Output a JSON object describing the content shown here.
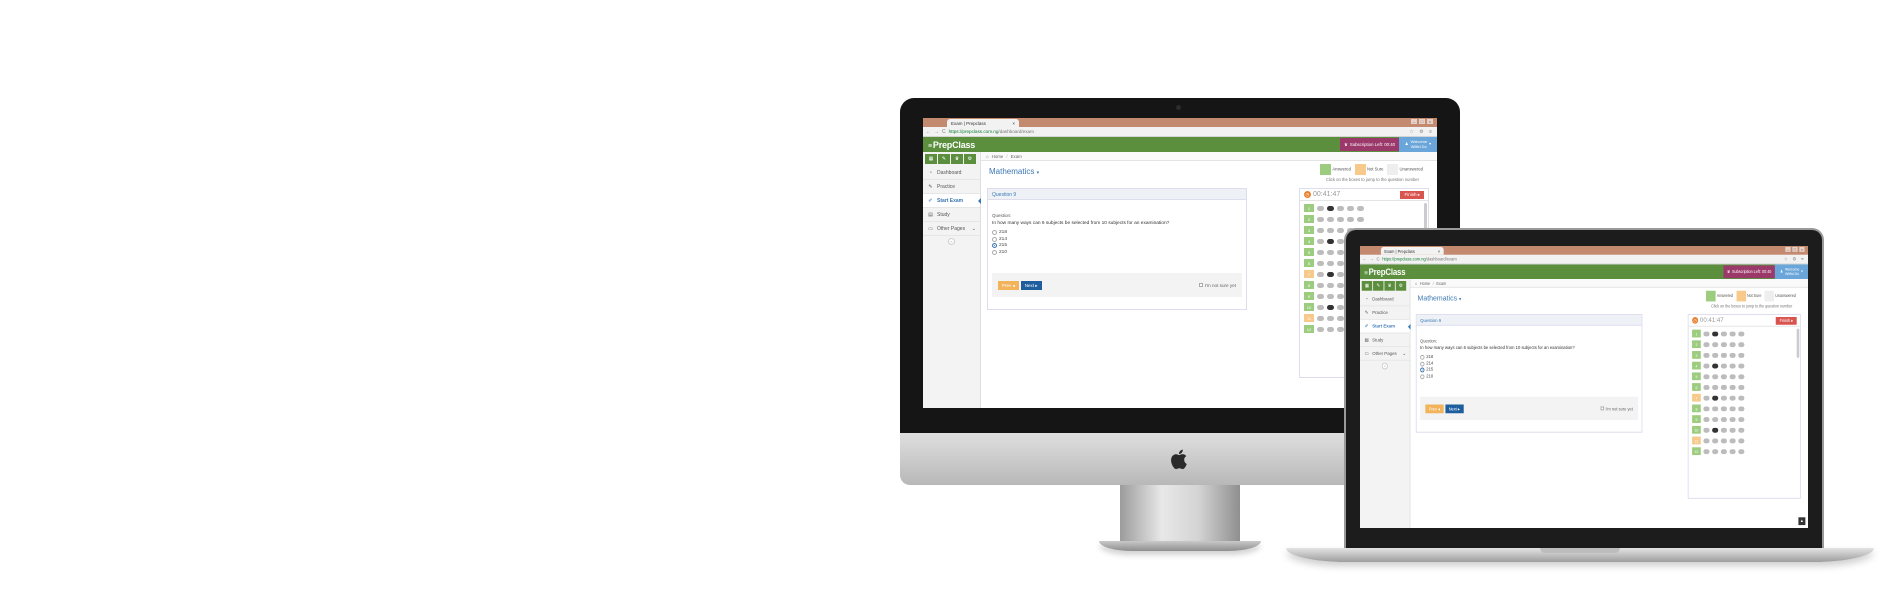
{
  "browser": {
    "tab_title": "Exam | Prepclass",
    "tab_close": "×",
    "url_host": "https://prepclass.com.ng",
    "url_path": "/dashboard/exam",
    "back": "←",
    "forward": "→",
    "reload": "C",
    "icons": "☆ ⚙ ≡",
    "win_min": "–",
    "win_max": "□",
    "win_close": "×"
  },
  "header": {
    "logo_mark": "≡",
    "logo": "PrepClass",
    "subscription_icon": "♛",
    "subscription": "Subscription Left: 00:40",
    "user_icon": "♟",
    "welcome": "Welcome",
    "user": "Wilfid Do",
    "user_caret": "▾"
  },
  "sidebar": {
    "shortcut_icons": [
      "▦",
      "✎",
      "♛",
      "⚙"
    ],
    "items": [
      {
        "icon": "◔",
        "label": "Dashboard"
      },
      {
        "icon": "✎",
        "label": "Practice"
      },
      {
        "icon": "✐",
        "label": "Start Exam"
      },
      {
        "icon": "▤",
        "label": "Study"
      },
      {
        "icon": "▭",
        "label": "Other Pages"
      }
    ],
    "chevron": "⌄",
    "collapse": "«"
  },
  "breadcrumb": {
    "home_icon": "⌂",
    "home": "Home",
    "sep": "/",
    "current": "Exam"
  },
  "page": {
    "title": "Mathematics",
    "caret": "▾"
  },
  "legend": {
    "answered": "Answered",
    "not_sure": "Not Sure",
    "unanswered": "Unanswered",
    "hint": "Click on the boxes to jump to the question number",
    "colors": {
      "answered": "#9ccc7e",
      "not_sure": "#f7c98a",
      "unanswered": "#eeeeee"
    }
  },
  "question": {
    "header": "Question 9",
    "label": "Question:",
    "text": "In how many ways can 6 subjects be selected from 10 subjects for an examination?",
    "options": [
      "218",
      "214",
      "215",
      "210"
    ],
    "selected_index": 2,
    "prev": "Prev ◂",
    "next": "Next ▸",
    "not_sure": "I'm not sure yet"
  },
  "timer": {
    "clock_icon": "◷",
    "value": "00:41:47",
    "finish": "Finish ▸"
  },
  "question_grid": [
    {
      "n": "1",
      "status": "answered"
    },
    {
      "n": "2",
      "status": "answered"
    },
    {
      "n": "3",
      "status": "answered"
    },
    {
      "n": "4",
      "status": "answered"
    },
    {
      "n": "5",
      "status": "answered"
    },
    {
      "n": "6",
      "status": "answered"
    },
    {
      "n": "7",
      "status": "not_sure"
    },
    {
      "n": "8",
      "status": "answered"
    },
    {
      "n": "9",
      "status": "answered"
    },
    {
      "n": "10",
      "status": "answered"
    },
    {
      "n": "11",
      "status": "not_sure"
    },
    {
      "n": "12",
      "status": "answered"
    }
  ],
  "back_to_top": "▴"
}
